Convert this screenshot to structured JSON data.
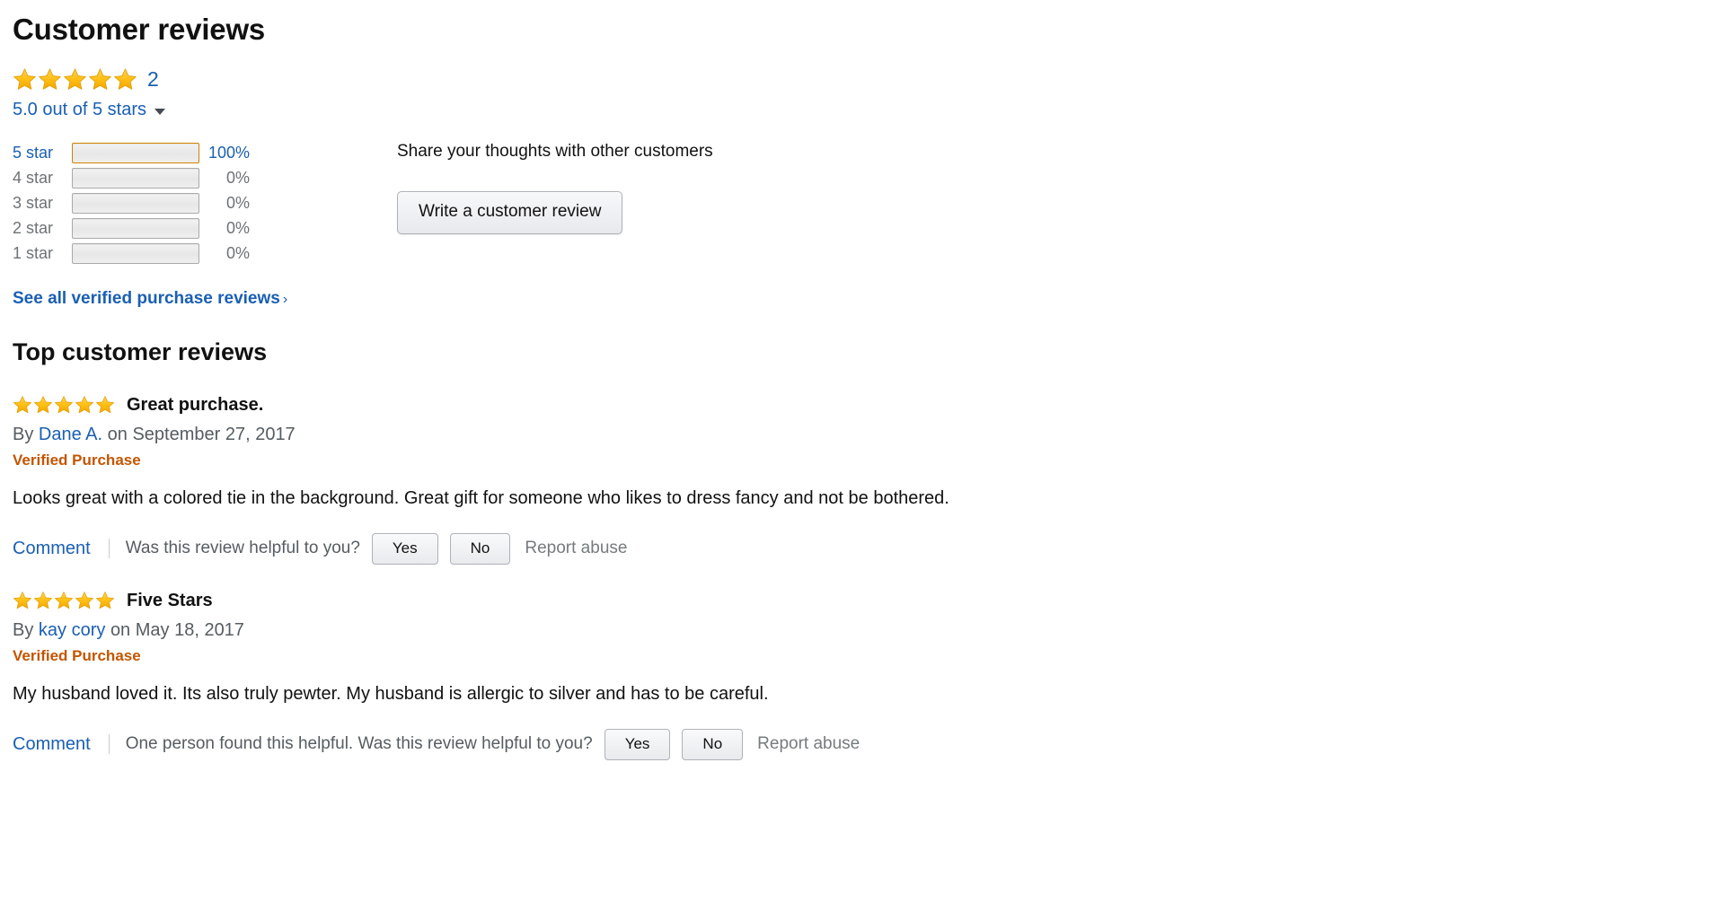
{
  "header": {
    "title": "Customer reviews"
  },
  "summary": {
    "star_rating": 5,
    "review_count": "2",
    "average_text": "5.0 out of 5 stars",
    "caret_icon": "chevron-down-icon"
  },
  "histogram": {
    "rows": [
      {
        "label": "5 star",
        "percent": "100%",
        "value": 100,
        "active": true
      },
      {
        "label": "4 star",
        "percent": "0%",
        "value": 0,
        "active": false
      },
      {
        "label": "3 star",
        "percent": "0%",
        "value": 0,
        "active": false
      },
      {
        "label": "2 star",
        "percent": "0%",
        "value": 0,
        "active": false
      },
      {
        "label": "1 star",
        "percent": "0%",
        "value": 0,
        "active": false
      }
    ]
  },
  "share": {
    "title": "Share your thoughts with other customers",
    "write_button": "Write a customer review"
  },
  "see_all": {
    "label": "See all verified purchase reviews",
    "chevron": "›"
  },
  "top_reviews": {
    "heading": "Top customer reviews",
    "items": [
      {
        "stars": 5,
        "title": "Great purchase.",
        "by_prefix": "By",
        "author": "Dane A.",
        "on_date": "on September 27, 2017",
        "verified": "Verified Purchase",
        "body": "Looks great with a colored tie in the background. Great gift for someone who likes to dress fancy and not be bothered.",
        "comment_label": "Comment",
        "helpful_text": "Was this review helpful to you?",
        "yes_label": "Yes",
        "no_label": "No",
        "report_label": "Report abuse"
      },
      {
        "stars": 5,
        "title": "Five Stars",
        "by_prefix": "By",
        "author": "kay cory",
        "on_date": "on May 18, 2017",
        "verified": "Verified Purchase",
        "body": "My husband loved it. Its also truly pewter. My husband is allergic to silver and has to be careful.",
        "comment_label": "Comment",
        "helpful_text": "One person found this helpful. Was this review helpful to you?",
        "yes_label": "Yes",
        "no_label": "No",
        "report_label": "Report abuse"
      }
    ]
  },
  "colors": {
    "link": "#1a5fb4",
    "star": "#ffb400",
    "verified": "#c45500",
    "muted": "#6d7275",
    "text": "#111111"
  }
}
